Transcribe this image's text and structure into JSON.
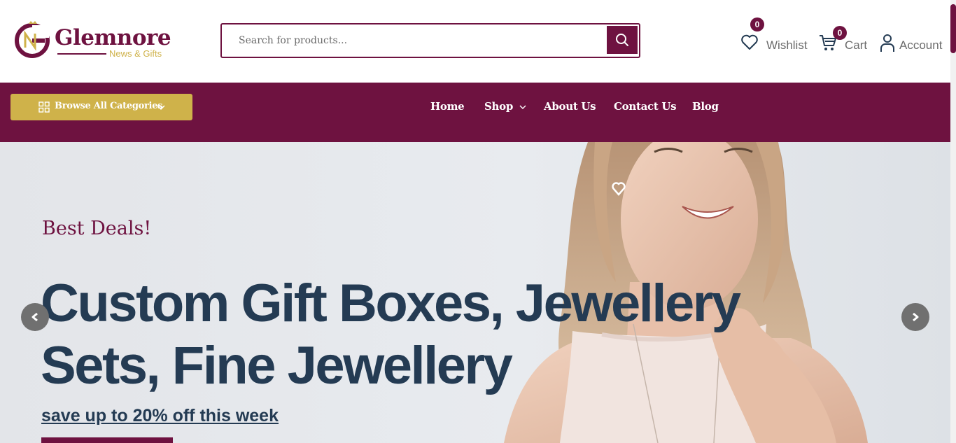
{
  "brand": {
    "name": "Glemnore",
    "tagline": "News & Gifts",
    "color": "#6e1240",
    "accent": "#cfb24a"
  },
  "search": {
    "placeholder": "Search for products...",
    "value": "",
    "icon": "search-icon"
  },
  "header_actions": {
    "wishlist": {
      "label": "Wishlist",
      "count": "0",
      "icon": "heart-icon"
    },
    "cart": {
      "label": "Cart",
      "count": "0",
      "icon": "cart-icon"
    },
    "account": {
      "label": "Account",
      "icon": "user-icon"
    }
  },
  "browse": {
    "label": "Browse All Categories",
    "icon": "grid-icon"
  },
  "nav": {
    "home": "Home",
    "shop": "Shop",
    "about": "About Us",
    "contact": "Contact Us",
    "blog": "Blog"
  },
  "hero": {
    "kicker": "Best Deals!",
    "title": "Custom Gift Boxes, Jewellery Sets, Fine Jewellery",
    "subtitle": "save up to 20% off this week",
    "text_color": "#243b53"
  }
}
